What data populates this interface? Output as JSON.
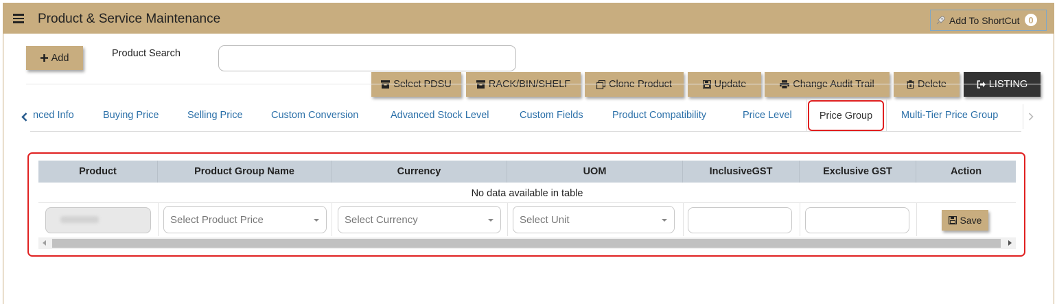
{
  "header": {
    "title": "Product & Service Maintenance",
    "shortcut_label": "Add To ShortCut",
    "shortcut_count": "0"
  },
  "toolbar": {
    "add_label": "Add",
    "search_label": "Product Search",
    "search_value": "",
    "buttons": {
      "select_pdsu": "Select PDSU",
      "rack_bin_shelf": "RACK/BIN/SHELF",
      "clone_product": "Clone Product",
      "update": "Update",
      "change_audit_trail": "Change Audit Trail",
      "delete": "Delete",
      "listing": "LISTING"
    }
  },
  "tabs": [
    {
      "label": "nced Info"
    },
    {
      "label": "Buying Price"
    },
    {
      "label": "Selling Price"
    },
    {
      "label": "Custom Conversion"
    },
    {
      "label": "Advanced Stock Level"
    },
    {
      "label": "Custom Fields"
    },
    {
      "label": "Product Compatibility"
    },
    {
      "label": "Price Level"
    },
    {
      "label": "Price Group",
      "active": true
    },
    {
      "label": "Multi-Tier Price Group"
    }
  ],
  "table": {
    "columns": [
      "Product",
      "Product Group Name",
      "Currency",
      "UOM",
      "InclusiveGST",
      "Exclusive GST",
      "Action"
    ],
    "empty_message": "No data available in table",
    "form": {
      "product_group_placeholder": "Select Product Price",
      "currency_placeholder": "Select Currency",
      "unit_placeholder": "Select Unit",
      "save_label": "Save"
    }
  },
  "colors": {
    "accent": "#c8ad7f",
    "highlight": "#e02020",
    "dark_button": "#333333",
    "header_row": "#c7d0d9"
  }
}
